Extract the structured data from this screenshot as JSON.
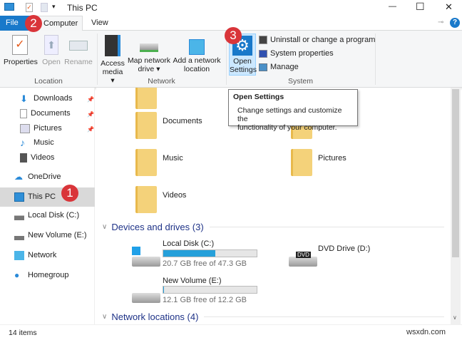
{
  "window": {
    "title": "This PC",
    "controls": {
      "minimize": "—",
      "maximize": "☐",
      "close": "✕"
    }
  },
  "tabs": [
    {
      "label": "File"
    },
    {
      "label": "Computer"
    },
    {
      "label": "View"
    }
  ],
  "ribbon": {
    "groups": [
      {
        "label": "Location",
        "buttons": [
          {
            "label": "Properties"
          },
          {
            "label": "Open"
          },
          {
            "label": "Rename"
          }
        ]
      },
      {
        "label": "Network",
        "buttons": [
          {
            "label1": "Access",
            "label2": "media ▾"
          },
          {
            "label1": "Map network",
            "label2": "drive ▾"
          },
          {
            "label1": "Add a network",
            "label2": "location"
          }
        ]
      },
      {
        "label": "System",
        "buttons": [
          {
            "label1": "Open",
            "label2": "Settings"
          },
          {
            "label": "Uninstall or change a program"
          },
          {
            "label": "System properties"
          },
          {
            "label": "Manage"
          }
        ]
      }
    ],
    "help": "?"
  },
  "tooltip": {
    "title": "Open Settings",
    "body1": "Change settings and customize the",
    "body2": "functionality of your computer."
  },
  "nav": {
    "items": [
      {
        "label": "Downloads"
      },
      {
        "label": "Documents"
      },
      {
        "label": "Pictures"
      },
      {
        "label": "Music"
      },
      {
        "label": "Videos"
      },
      {
        "label": "OneDrive"
      },
      {
        "label": "This PC"
      },
      {
        "label": "Local Disk (C:)"
      },
      {
        "label": "New Volume (E:)"
      },
      {
        "label": "Network"
      },
      {
        "label": "Homegroup"
      }
    ]
  },
  "folders": [
    {
      "label": "Documents"
    },
    {
      "label": "Music"
    },
    {
      "label": "Pictures"
    },
    {
      "label": "Videos"
    }
  ],
  "sections": {
    "devices": "Devices and drives (3)",
    "network": "Network locations (4)"
  },
  "drives": [
    {
      "label": "Local Disk (C:)",
      "free": "20.7 GB free of 47.3 GB",
      "used_fraction": 0.56
    },
    {
      "label": "New Volume (E:)",
      "free": "12.1 GB free of 12.2 GB",
      "used_fraction": 0.01
    },
    {
      "label": "DVD Drive (D:)",
      "badge": "DVD"
    }
  ],
  "badges": [
    "1",
    "2",
    "3"
  ],
  "status": {
    "items": "14 items"
  },
  "watermark": "wsxdn.com",
  "colors": {
    "accent": "#1979ca",
    "badge": "#d9353a",
    "bar": "#26a0da"
  }
}
